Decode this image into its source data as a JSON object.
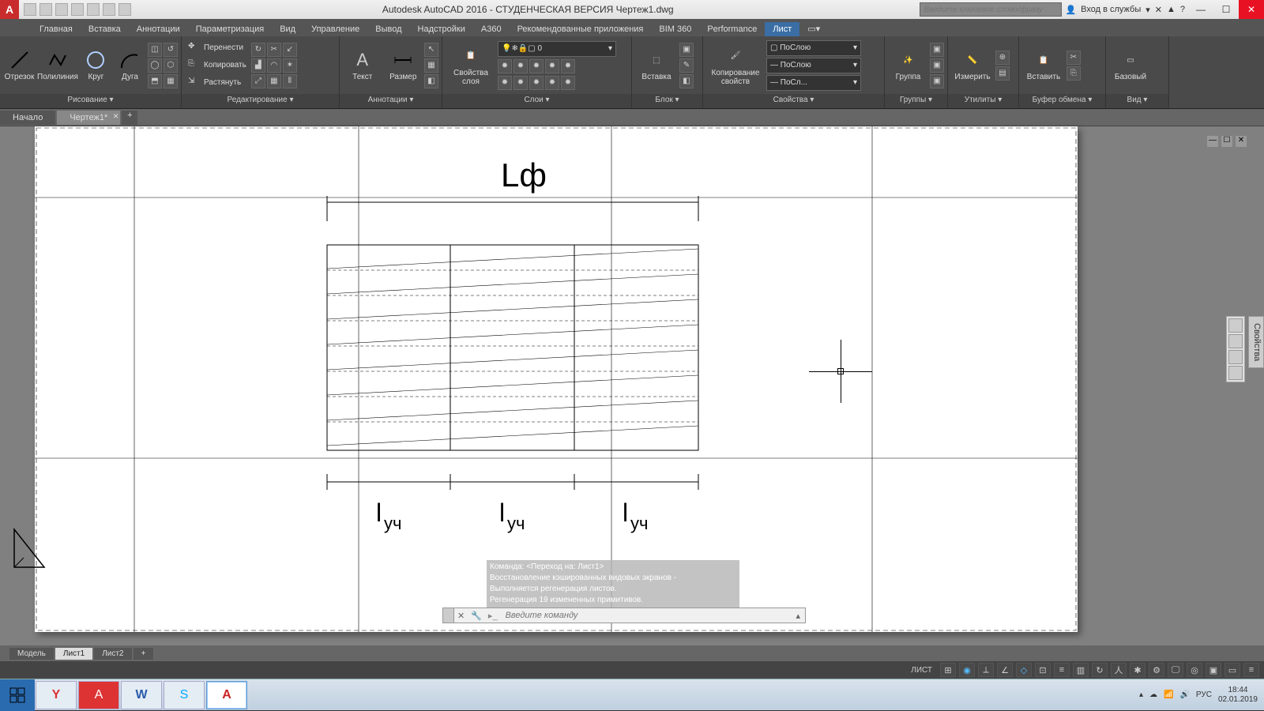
{
  "title": "Autodesk AutoCAD 2016 - СТУДЕНЧЕСКАЯ ВЕРСИЯ   Чертеж1.dwg",
  "search_placeholder": "Введите ключевое слово/фразу",
  "signin": "Вход в службы",
  "menutabs": [
    "Главная",
    "Вставка",
    "Аннотации",
    "Параметризация",
    "Вид",
    "Управление",
    "Вывод",
    "Надстройки",
    "A360",
    "Рекомендованные приложения",
    "BIM 360",
    "Performance",
    "Лист"
  ],
  "active_menutab": 12,
  "ribbon": {
    "draw": {
      "title": "Рисование ▾",
      "items": [
        "Отрезок",
        "Полилиния",
        "Круг",
        "Дуга"
      ]
    },
    "edit": {
      "title": "Редактирование ▾",
      "items": [
        "Перенести",
        "Копировать",
        "Растянуть"
      ]
    },
    "annot": {
      "title": "Аннотации ▾",
      "text": "Текст",
      "dim": "Размер"
    },
    "layers": {
      "title": "Слои ▾",
      "props": "Свойства\nслоя",
      "current": "0"
    },
    "block": {
      "title": "Блок ▾",
      "insert": "Вставка"
    },
    "props": {
      "title": "Свойства ▾",
      "match": "Копирование\nсвойств",
      "bylayer": "ПоСлою",
      "bylayer2": "ПоСлою",
      "bylayer3": "ПоСл..."
    },
    "groups": {
      "title": "Группы ▾",
      "group": "Группа"
    },
    "utils": {
      "title": "Утилиты ▾",
      "measure": "Измерить"
    },
    "clip": {
      "title": "Буфер обмена ▾",
      "paste": "Вставить"
    },
    "view": {
      "title": "Вид ▾",
      "base": "Базовый"
    }
  },
  "filetabs": {
    "start": "Начало",
    "current": "Чертеж1*"
  },
  "drawing": {
    "label_top": "Lф",
    "label_bottom": "lуч"
  },
  "cmdhistory": [
    "Команда:  <Переход на: Лист1>",
    "Восстановление кэшированных видовых экранов -",
    "Выполняется регенерация листов.",
    "Регенерация 19 измененных примитивов."
  ],
  "cmd_placeholder": "Введите команду",
  "props_label": "Свойства",
  "layouttabs": [
    "Модель",
    "Лист1",
    "Лист2"
  ],
  "active_layouttab": 1,
  "status": {
    "space": "ЛИСТ"
  },
  "tray": {
    "lang": "РУС",
    "time": "18:44",
    "date": "02.01.2019"
  }
}
